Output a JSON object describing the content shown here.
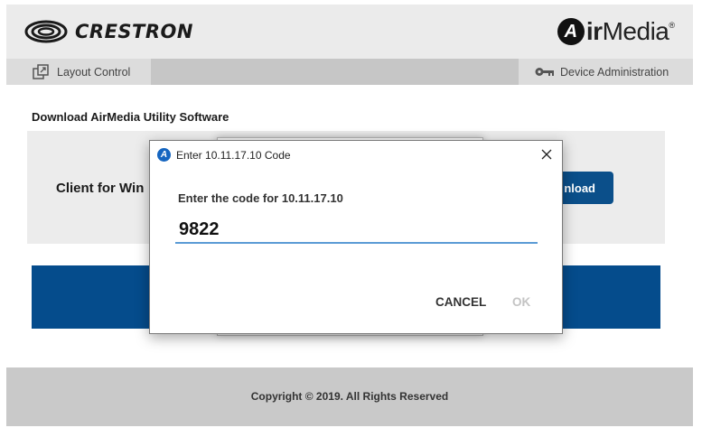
{
  "header": {
    "brand": "CRESTRON",
    "product_prefix": "A",
    "product_rest": "ir",
    "product_suffix": "Media",
    "registered": "®"
  },
  "nav": {
    "layout_control": "Layout Control",
    "device_administration": "Device Administration",
    "layout_icon": "window-restore-icon",
    "device_icon": "key-icon"
  },
  "main": {
    "section_title": "Download AirMedia Utility Software",
    "client_label": "Client for Win",
    "download_label": "nload"
  },
  "dialog": {
    "title": "Enter 10.11.17.10 Code",
    "prompt": "Enter the code for 10.11.17.10",
    "code_value": "9822",
    "cancel_label": "CANCEL",
    "ok_label": "OK"
  },
  "footer": {
    "copyright": "Copyright © 2019. All Rights Reserved"
  },
  "colors": {
    "accent_blue": "#054c8c",
    "button_blue": "#0b4f8a",
    "input_underline": "#5b9bd5"
  }
}
